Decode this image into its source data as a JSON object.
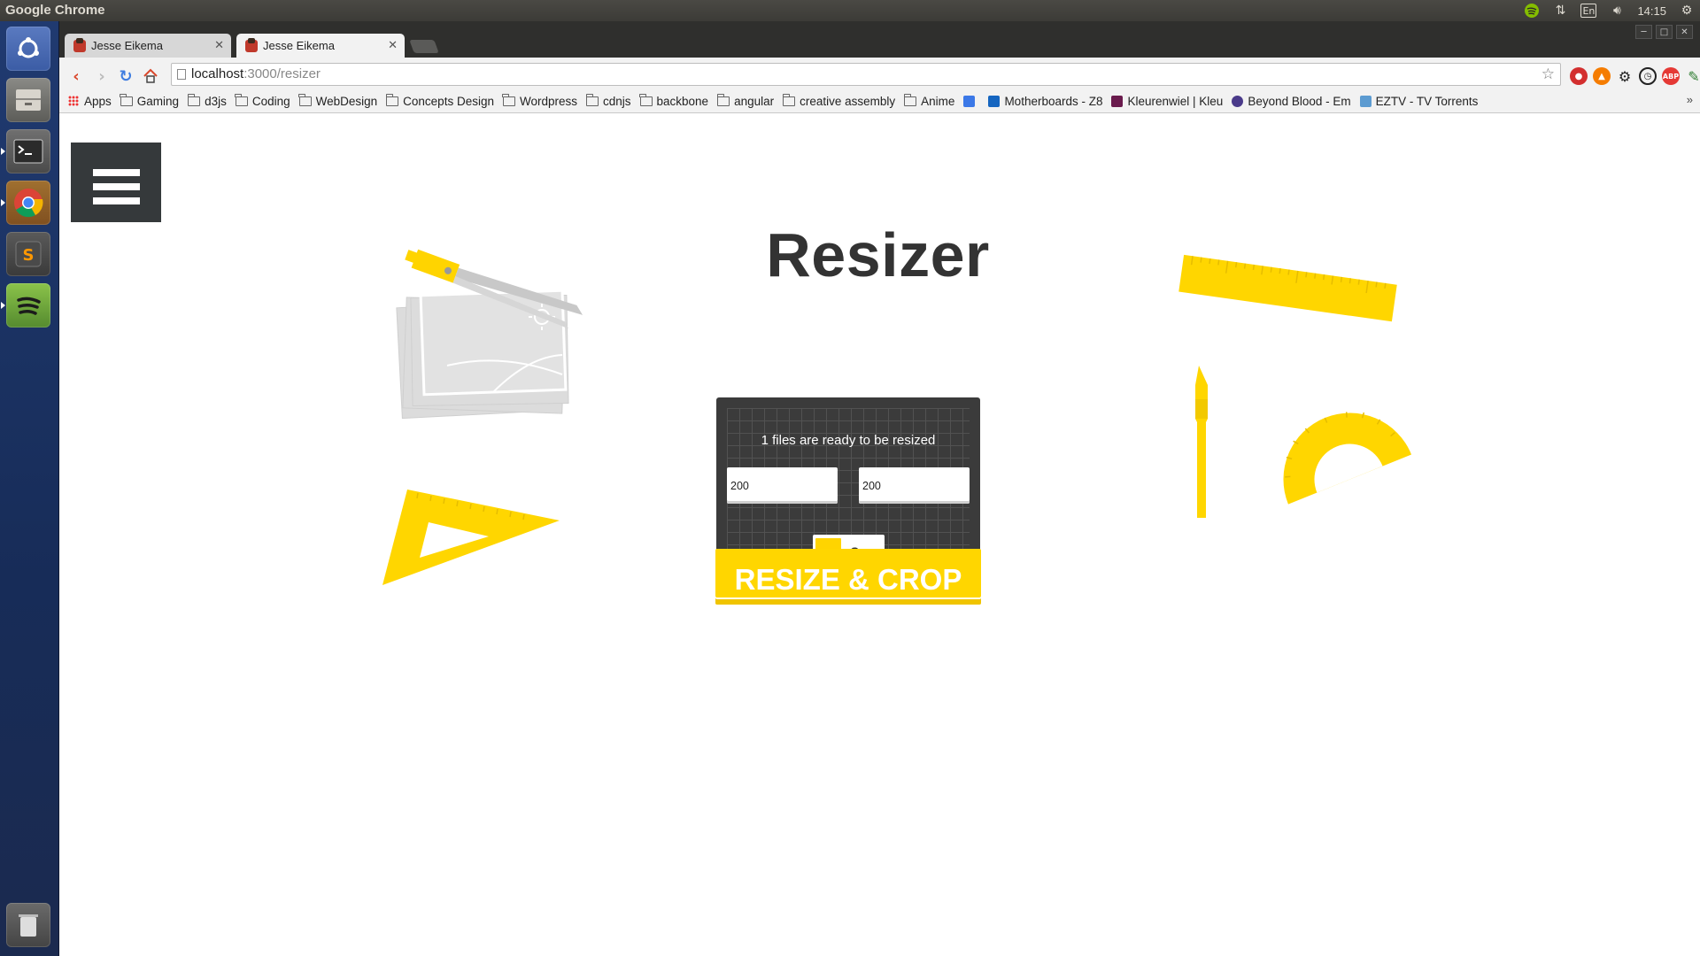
{
  "os": {
    "app_title": "Google Chrome",
    "clock": "14:15",
    "keyboard_layout": "En"
  },
  "browser": {
    "tabs": [
      {
        "label": "Jesse Eikema",
        "active": false
      },
      {
        "label": "Jesse Eikema",
        "active": true
      }
    ],
    "url": {
      "host": "localhost",
      "rest": ":3000/resizer"
    },
    "bookmarks": [
      {
        "label": "Apps",
        "type": "apps"
      },
      {
        "label": "Gaming",
        "type": "folder"
      },
      {
        "label": "d3js",
        "type": "folder"
      },
      {
        "label": "Coding",
        "type": "folder"
      },
      {
        "label": "WebDesign",
        "type": "folder"
      },
      {
        "label": "Concepts Design",
        "type": "folder"
      },
      {
        "label": "Wordpress",
        "type": "folder"
      },
      {
        "label": "cdnjs",
        "type": "folder"
      },
      {
        "label": "backbone",
        "type": "folder"
      },
      {
        "label": "angular",
        "type": "folder"
      },
      {
        "label": "creative assembly",
        "type": "folder"
      },
      {
        "label": "Anime",
        "type": "folder"
      },
      {
        "label": "",
        "type": "calendar"
      },
      {
        "label": "Motherboards - Z8",
        "type": "site"
      },
      {
        "label": "Kleurenwiel | Kleu",
        "type": "site"
      },
      {
        "label": "Beyond Blood - Em",
        "type": "site"
      },
      {
        "label": "EZTV - TV Torrents",
        "type": "site"
      }
    ],
    "overflow_label": "»"
  },
  "page": {
    "title": "Resizer",
    "status": "1 files are ready to be resized",
    "width_value": "200",
    "height_value": "200",
    "crop_label": "Crop",
    "cta_label": "RESIZE & CROP"
  },
  "colors": {
    "accent": "#ffd600",
    "panel": "#3b3b3b",
    "menu": "#35393b"
  }
}
